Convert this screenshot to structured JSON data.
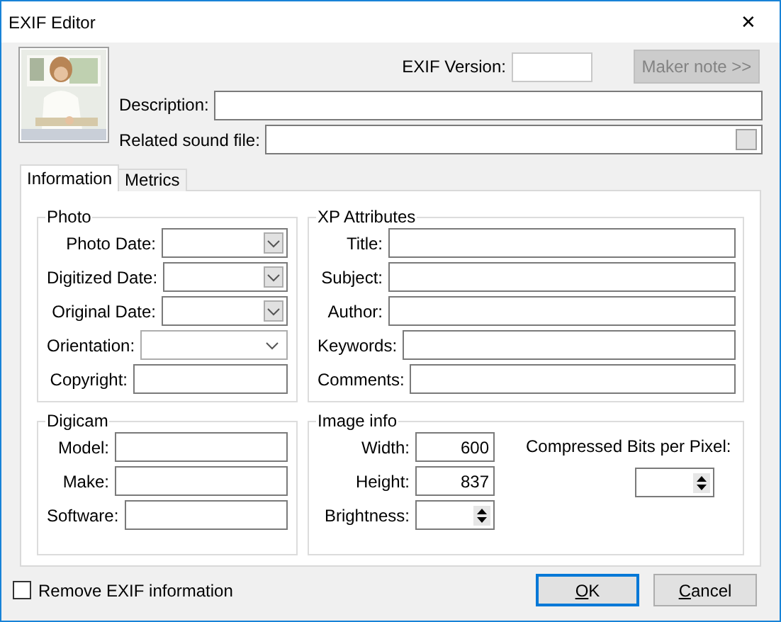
{
  "window": {
    "title": "EXIF Editor",
    "close": "✕"
  },
  "header": {
    "exif_version": {
      "label": "EXIF Version:"
    },
    "maker_note_button": {
      "label": "Maker note >>",
      "disabled": true
    },
    "description": {
      "label": "Description:"
    },
    "sound_file": {
      "label": "Related sound file:"
    }
  },
  "tabs": [
    {
      "label": "Information",
      "selected": true
    },
    {
      "label": "Metrics",
      "selected": false
    }
  ],
  "groups": [
    {
      "title": "Photo",
      "fields": [
        {
          "label": "Photo Date:",
          "kind": "date"
        },
        {
          "label": "Digitized Date:",
          "kind": "date"
        },
        {
          "label": "Original Date:",
          "kind": "date"
        },
        {
          "label": "Orientation:",
          "kind": "dropdown"
        },
        {
          "label": "Copyright:",
          "kind": "text"
        }
      ]
    },
    {
      "title": "XP Attributes",
      "fields": [
        {
          "label": "Title:",
          "kind": "text"
        },
        {
          "label": "Subject:",
          "kind": "text"
        },
        {
          "label": "Author:",
          "kind": "text"
        },
        {
          "label": "Keywords:",
          "kind": "text"
        },
        {
          "label": "Comments:",
          "kind": "text"
        }
      ]
    },
    {
      "title": "Digicam",
      "fields": [
        {
          "label": "Model:",
          "kind": "text"
        },
        {
          "label": "Make:",
          "kind": "text"
        },
        {
          "label": "Software:",
          "kind": "text"
        }
      ]
    },
    {
      "title": "Image info",
      "fields": [
        {
          "label": "Width:",
          "kind": "number",
          "value": "600"
        },
        {
          "label": "Height:",
          "kind": "number",
          "value": "837"
        },
        {
          "label": "Brightness:",
          "kind": "spinner"
        }
      ],
      "extra": {
        "label": "Compressed Bits per Pixel:",
        "kind": "spinner"
      }
    }
  ],
  "remove_exif": {
    "label": "Remove EXIF information",
    "checked": false
  },
  "buttons": [
    {
      "label": "OK",
      "default": true
    },
    {
      "label": "Cancel",
      "default": false
    }
  ]
}
